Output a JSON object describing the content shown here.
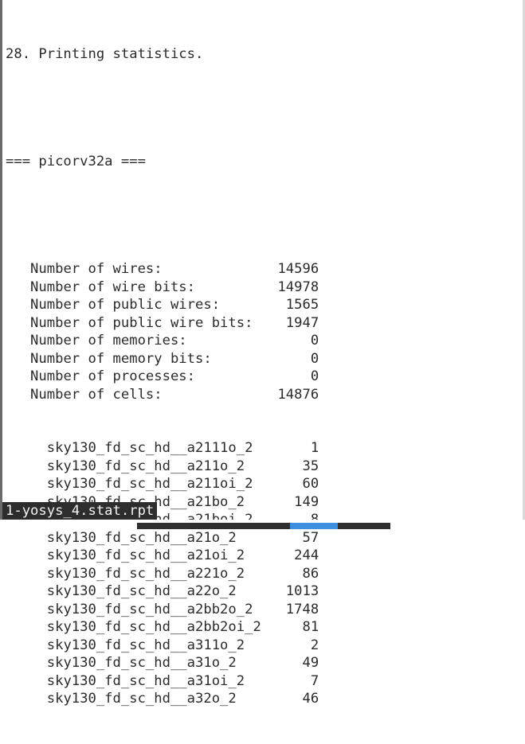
{
  "terminal": {
    "section_header": "28. Printing statistics.",
    "module_header": "=== picorv32a ===",
    "stats": [
      {
        "label": "Number of wires:",
        "value": "14596"
      },
      {
        "label": "Number of wire bits:",
        "value": "14978"
      },
      {
        "label": "Number of public wires:",
        "value": "1565"
      },
      {
        "label": "Number of public wire bits:",
        "value": "1947"
      },
      {
        "label": "Number of memories:",
        "value": "0"
      },
      {
        "label": "Number of memory bits:",
        "value": "0"
      },
      {
        "label": "Number of processes:",
        "value": "0"
      },
      {
        "label": "Number of cells:",
        "value": "14876"
      }
    ],
    "cells": [
      {
        "name": "sky130_fd_sc_hd__a2111o_2",
        "count": "1"
      },
      {
        "name": "sky130_fd_sc_hd__a211o_2",
        "count": "35"
      },
      {
        "name": "sky130_fd_sc_hd__a211oi_2",
        "count": "60"
      },
      {
        "name": "sky130_fd_sc_hd__a21bo_2",
        "count": "149"
      },
      {
        "name": "sky130_fd_sc_hd__a21boi_2",
        "count": "8"
      },
      {
        "name": "sky130_fd_sc_hd__a21o_2",
        "count": "57"
      },
      {
        "name": "sky130_fd_sc_hd__a21oi_2",
        "count": "244"
      },
      {
        "name": "sky130_fd_sc_hd__a221o_2",
        "count": "86"
      },
      {
        "name": "sky130_fd_sc_hd__a22o_2",
        "count": "1013"
      },
      {
        "name": "sky130_fd_sc_hd__a2bb2o_2",
        "count": "1748"
      },
      {
        "name": "sky130_fd_sc_hd__a2bb2oi_2",
        "count": "81"
      },
      {
        "name": "sky130_fd_sc_hd__a311o_2",
        "count": "2"
      },
      {
        "name": "sky130_fd_sc_hd__a31o_2",
        "count": "49"
      },
      {
        "name": "sky130_fd_sc_hd__a31oi_2",
        "count": "7"
      },
      {
        "name": "sky130_fd_sc_hd__a32o_2",
        "count": "46"
      }
    ]
  },
  "status_bar": {
    "filename": "1-yosys_4.stat.rpt"
  },
  "colors": {
    "text": "#2b2b2b",
    "status_bg": "#2d2d2d",
    "taskbar_active": "#3d8fe0"
  }
}
